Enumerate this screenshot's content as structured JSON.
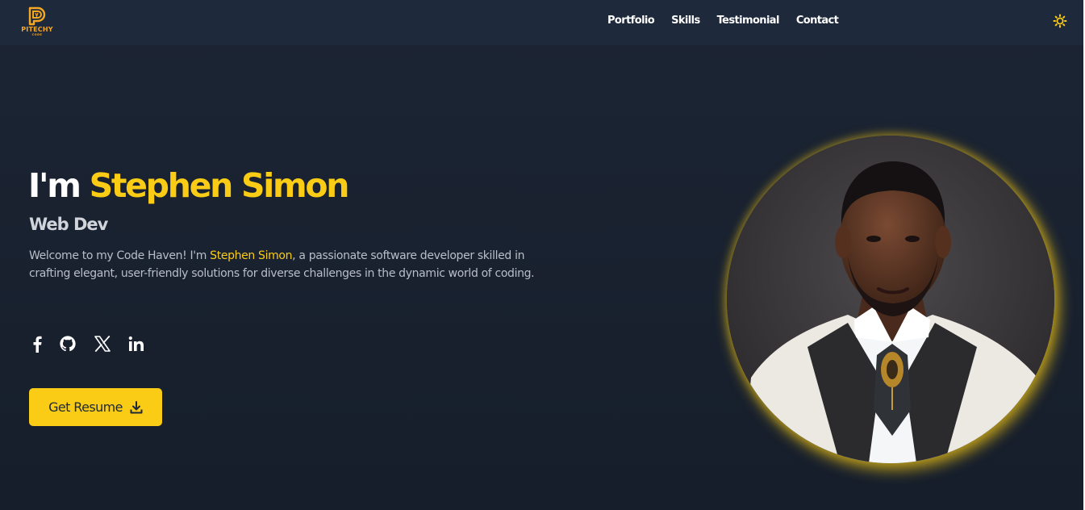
{
  "brand": {
    "name": "PITECHY",
    "sub": "CODE"
  },
  "nav": {
    "links": [
      "Portfolio",
      "Skills",
      "Testimonial",
      "Contact"
    ]
  },
  "hero": {
    "greeting": "I'm",
    "name": "Stephen Simon",
    "role": "Web Dev",
    "intro_before": "Welcome to my Code Haven! I'm ",
    "intro_name": "Stephen Simon",
    "intro_after": ", a passionate software developer skilled in crafting elegant, user-friendly solutions for diverse challenges in the dynamic world of coding.",
    "resume_label": "Get Resume"
  },
  "socials": [
    "facebook-icon",
    "github-icon",
    "x-icon",
    "linkedin-icon"
  ],
  "colors": {
    "background": "#1c2534",
    "navbar": "#1e293b",
    "accent": "#facc15",
    "logo": "#f5a623"
  }
}
